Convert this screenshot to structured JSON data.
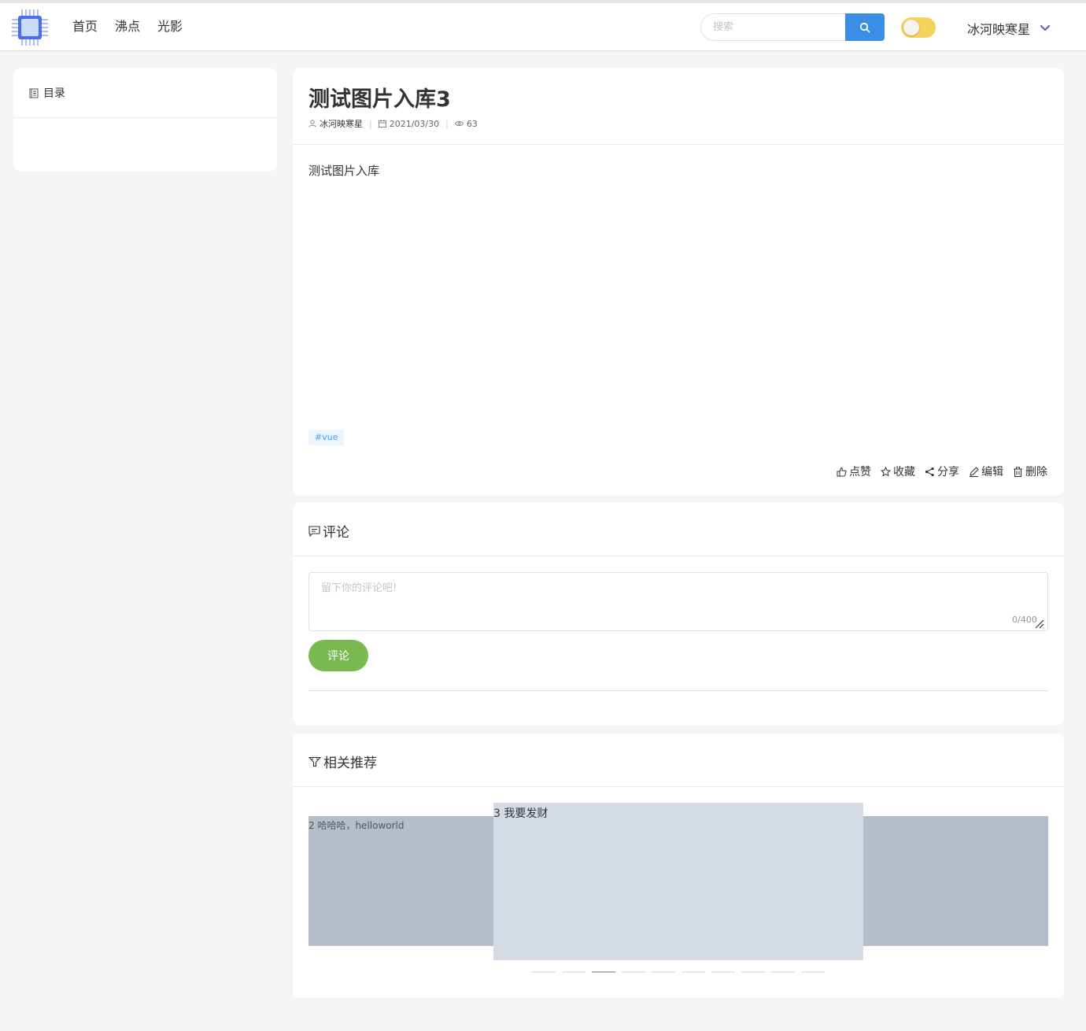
{
  "header": {
    "nav": [
      "首页",
      "沸点",
      "光影"
    ],
    "search_placeholder": "搜索",
    "username": "冰河映寒星"
  },
  "toc": {
    "title": "目录"
  },
  "article": {
    "title": "测试图片入库3",
    "author": "冰河映寒星",
    "date": "2021/03/30",
    "views": "63",
    "body": "测试图片入库",
    "tag": "#vue",
    "actions": [
      "点赞",
      "收藏",
      "分享",
      "编辑",
      "删除"
    ]
  },
  "comment": {
    "title": "评论",
    "placeholder": "留下你的评论吧!",
    "counter": "0/400",
    "submit": "评论"
  },
  "recommend": {
    "title": "相关推荐",
    "slides": [
      {
        "text": "2 哈哈哈，helloworld"
      },
      {
        "text": "3 我要发财"
      },
      {
        "text": ""
      }
    ],
    "dot_count": 10,
    "active_dot": 3
  },
  "colors": {
    "accent": "#3a8ee6",
    "comment_button": "#7ab94f",
    "toggle": "#f7d25a",
    "user_chevron": "#6b5fc7"
  }
}
